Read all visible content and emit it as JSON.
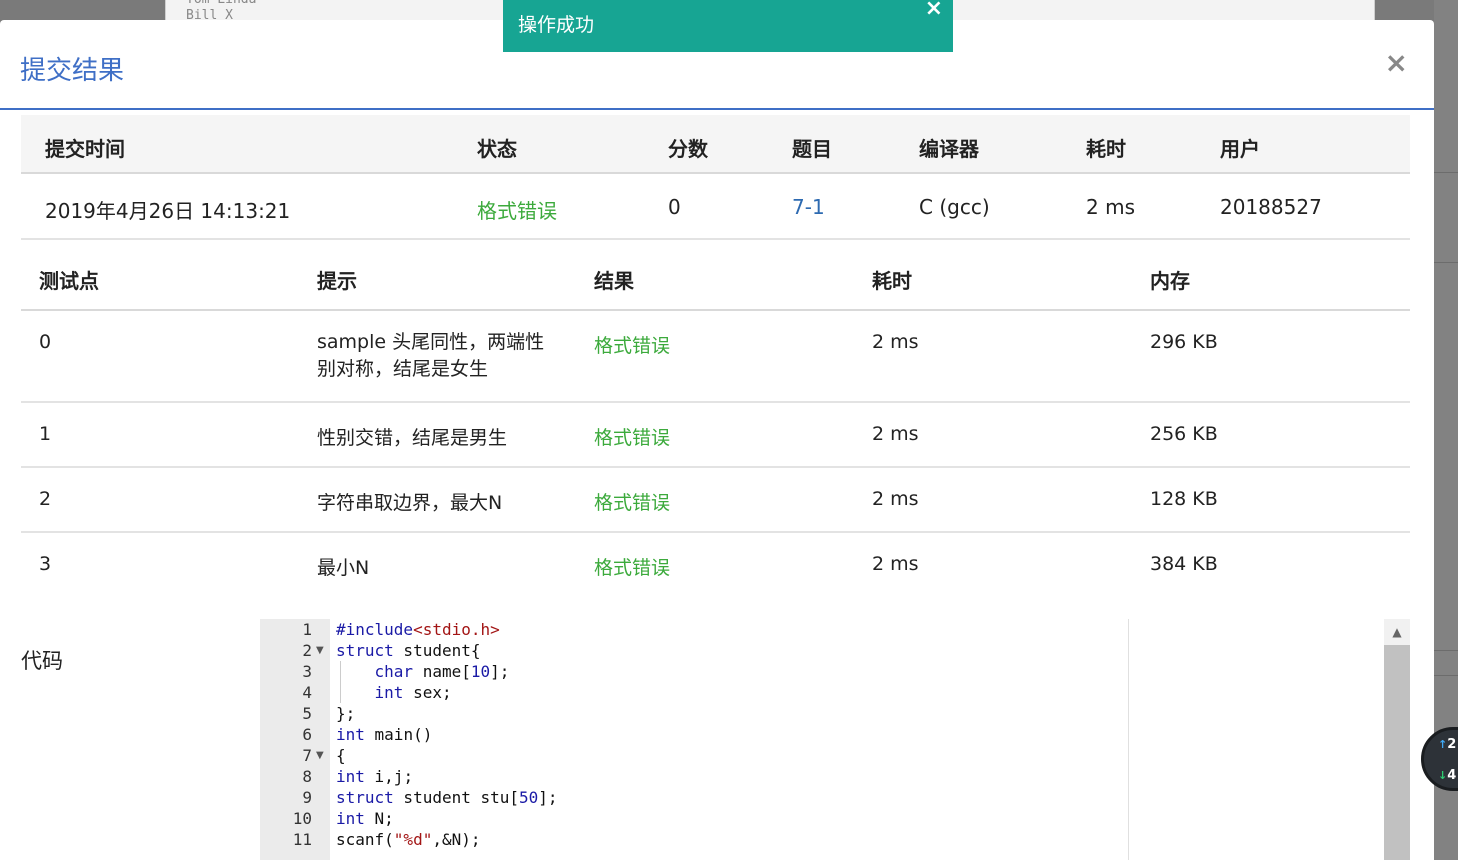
{
  "background": {
    "text": "Tom Linda\nBill X"
  },
  "toast": {
    "message": "操作成功",
    "close": "×"
  },
  "modal": {
    "title": "提交结果",
    "close": "×"
  },
  "summary": {
    "headers": [
      "提交时间",
      "状态",
      "分数",
      "题目",
      "编译器",
      "耗时",
      "用户"
    ],
    "row": {
      "time": "2019年4月26日 14:13:21",
      "status": "格式错误",
      "score": "0",
      "problem": "7-1",
      "compiler": "C (gcc)",
      "duration": "2 ms",
      "user": "20188527"
    }
  },
  "cases": {
    "headers": [
      "测试点",
      "提示",
      "结果",
      "耗时",
      "内存"
    ],
    "rows": [
      {
        "id": "0",
        "hint": "sample 头尾同性，两端性别对称，结尾是女生",
        "result": "格式错误",
        "time": "2 ms",
        "memory": "296 KB"
      },
      {
        "id": "1",
        "hint": "性别交错，结尾是男生",
        "result": "格式错误",
        "time": "2 ms",
        "memory": "256 KB"
      },
      {
        "id": "2",
        "hint": "字符串取边界，最大N",
        "result": "格式错误",
        "time": "2 ms",
        "memory": "128 KB"
      },
      {
        "id": "3",
        "hint": "最小N",
        "result": "格式错误",
        "time": "2 ms",
        "memory": "384 KB"
      }
    ]
  },
  "code_section": {
    "label": "代码",
    "line_numbers": [
      "1",
      "2",
      "3",
      "4",
      "5",
      "6",
      "7",
      "8",
      "9",
      "10",
      "11"
    ],
    "lines": [
      "#include<stdio.h>",
      "struct student{",
      "    char name[10];",
      "    int sex;",
      "};",
      "int main()",
      "{",
      "int i,j;",
      "struct student stu[50];",
      "int N;",
      "scanf(\"%d\",&N);"
    ]
  },
  "widget": {
    "up": "2",
    "down": "4"
  }
}
